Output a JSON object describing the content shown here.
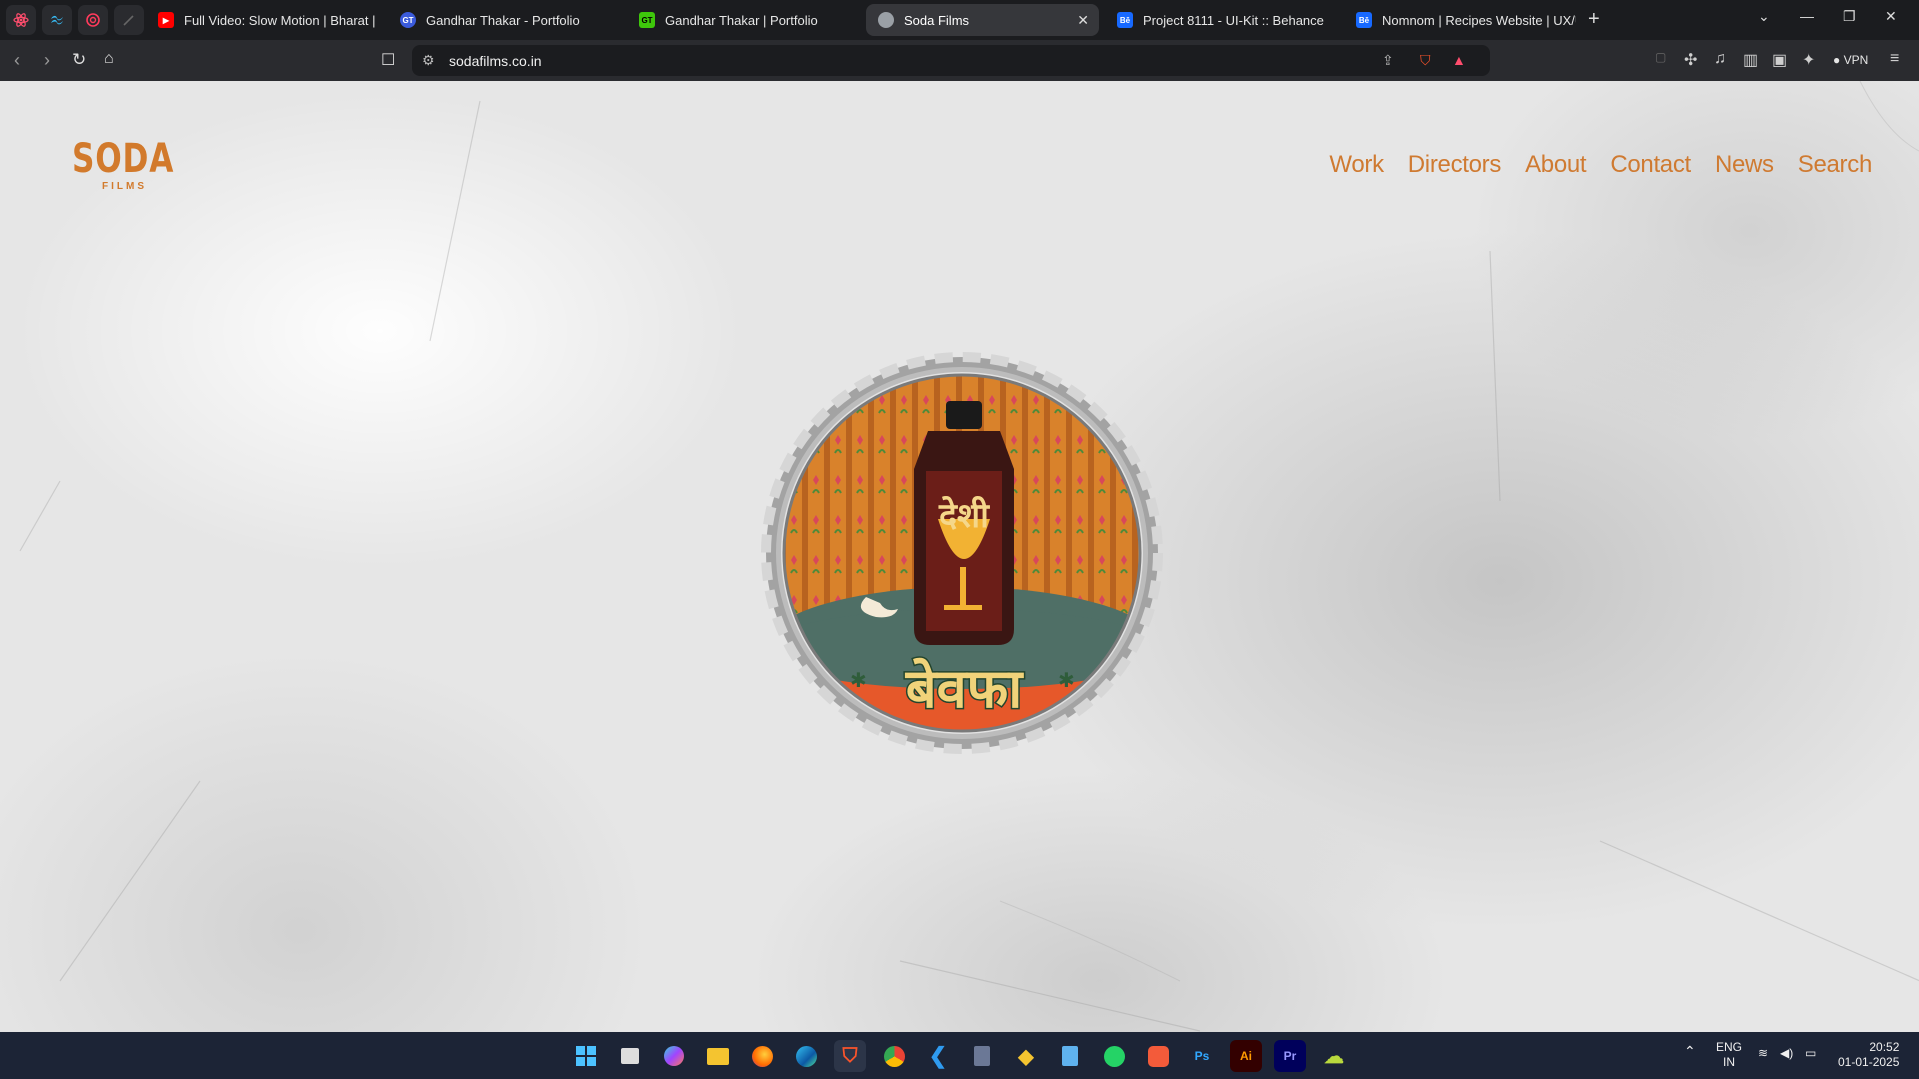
{
  "browser": {
    "tabs": [
      {
        "title": "Full Video: Slow Motion | Bharat | Sa",
        "favicon_color": "#ff0000"
      },
      {
        "title": "Gandhar Thakar - Portfolio",
        "favicon_color": "#3b5bdb",
        "favicon_text": "GT"
      },
      {
        "title": "Gandhar Thakar | Portfolio",
        "favicon_color": "#3ec70b",
        "favicon_text": "GT"
      },
      {
        "title": "Soda Films",
        "favicon_color": "#9aa0a6"
      },
      {
        "title": "Project 8111 - UI-Kit :: Behance",
        "favicon_color": "#1769ff",
        "favicon_text": "Bē"
      },
      {
        "title": "Nomnom | Recipes Website | UX/UI",
        "favicon_color": "#1769ff",
        "favicon_text": "Bē"
      }
    ],
    "address": "sodafilms.co.in",
    "vpn_label": "VPN"
  },
  "site": {
    "logo_main": "SODA",
    "logo_sub": "FILMS",
    "nav": [
      "Work",
      "Directors",
      "About",
      "Contact",
      "News",
      "Search"
    ],
    "accent": "#cf7a31",
    "cap_label_top": "देशी",
    "cap_label_bottom": "बेवफा"
  },
  "taskbar": {
    "lang": "ENG",
    "region": "IN",
    "time": "20:52",
    "date": "01-01-2025",
    "icons": [
      "windows-start",
      "task-view",
      "copilot",
      "file-explorer",
      "firefox",
      "edge",
      "brave",
      "chrome",
      "vscode",
      "calculator",
      "git",
      "notepad",
      "whatsapp",
      "photo-app",
      "photoshop",
      "illustrator",
      "premiere",
      "onedrive"
    ],
    "icon_labels": {
      "photoshop": "Ps",
      "illustrator": "Ai",
      "premiere": "Pr"
    }
  }
}
